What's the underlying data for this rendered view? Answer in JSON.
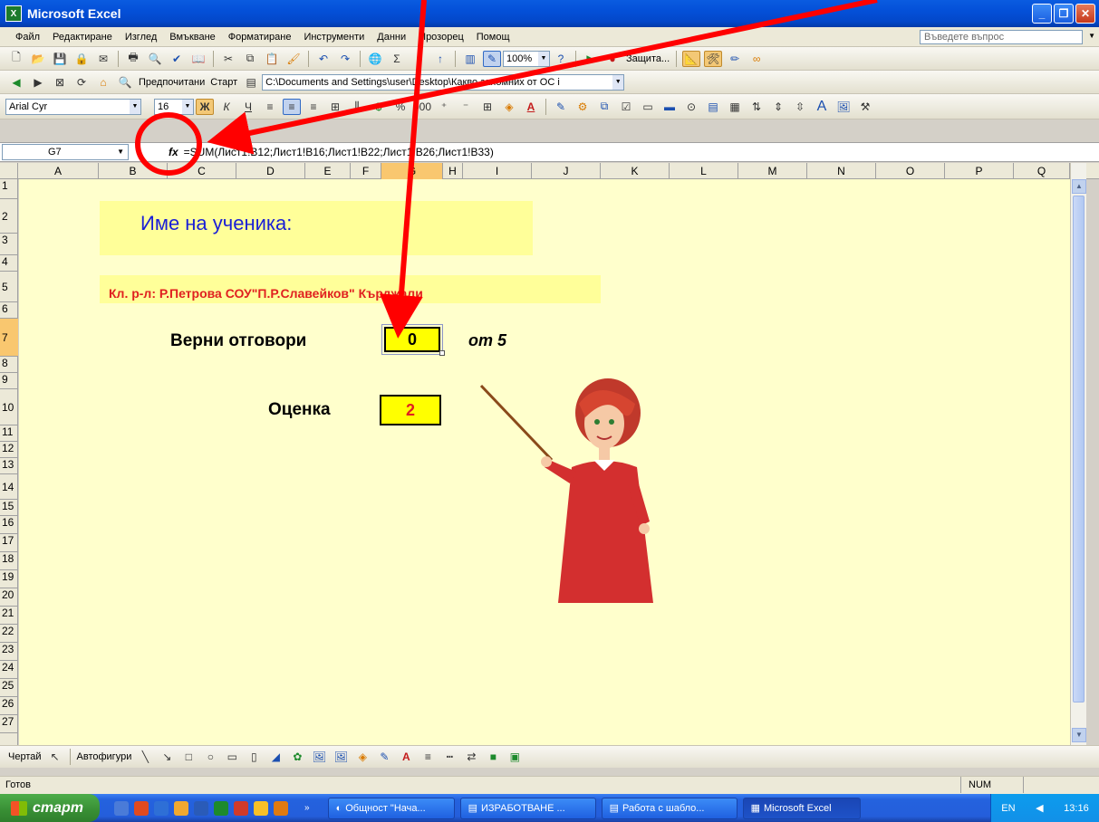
{
  "window": {
    "title": "Microsoft Excel",
    "app_icon": "X"
  },
  "menu": {
    "items": [
      "Файл",
      "Редактиране",
      "Изглед",
      "Вмъкване",
      "Форматиране",
      "Инструменти",
      "Данни",
      "Прозорец",
      "Помощ"
    ],
    "help_placeholder": "Въведете въпрос"
  },
  "toolbar_standard": {
    "zoom": "100%",
    "protection_label": "Защита..."
  },
  "toolbar_web": {
    "favorites_label": "Предпочитани",
    "go_label": "Старт",
    "address": "C:\\Documents and Settings\\user\\Desktop\\Какво запомних от ОС і"
  },
  "toolbar_format": {
    "font": "Arial Cyr",
    "font_size": "16",
    "percent": "%",
    "thousands": "000"
  },
  "formula_bar": {
    "cell_ref": "G7",
    "fx": "fx",
    "formula": "=SUM(Лист1!B12;Лист1!B16;Лист1!B22;Лист1!B26;Лист1!B33)"
  },
  "columns": [
    "A",
    "B",
    "C",
    "D",
    "E",
    "F",
    "G",
    "H",
    "I",
    "J",
    "K",
    "L",
    "M",
    "N",
    "O",
    "P",
    "Q"
  ],
  "rows": [
    "1",
    "2",
    "3",
    "4",
    "5",
    "6",
    "7",
    "8",
    "9",
    "10",
    "11",
    "12",
    "13",
    "14",
    "15",
    "16",
    "17",
    "18",
    "19",
    "20",
    "21",
    "22",
    "23",
    "24",
    "25",
    "26",
    "27"
  ],
  "sheet": {
    "student_name_label": "Име на ученика:",
    "class_teacher": "Кл. р-л: Р.Петрова СОУ\"П.Р.Славейков\" Кърджали",
    "correct_answers_label": "Верни отговори",
    "correct_answers_value": "0",
    "out_of": "от 5",
    "grade_label": "Оценка",
    "grade_value": "2"
  },
  "drawing_toolbar": {
    "draw_label": "Чертай",
    "autoshapes_label": "Автофигури"
  },
  "status": {
    "ready": "Готов",
    "num": "NUM"
  },
  "taskbar": {
    "start": "старт",
    "buttons": [
      "Общност \"Нача...",
      "ИЗРАБОТВАНЕ ...",
      "Работа с шабло...",
      "Microsoft Excel"
    ],
    "lang": "EN",
    "time": "13:16"
  },
  "colors": {
    "sheet_bg": "#ffffcc",
    "banner_bg": "#ffff99",
    "highlight": "#ffff00",
    "annotation": "#ff0000",
    "title_blue": "#1a1fd6",
    "red_text": "#e02020"
  }
}
